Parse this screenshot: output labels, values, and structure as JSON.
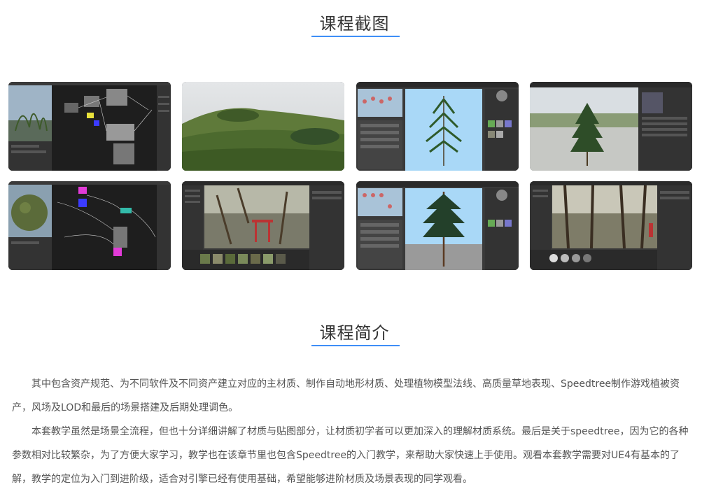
{
  "screenshots_section": {
    "title": "课程截图"
  },
  "gallery": [
    {
      "id": "shot-1",
      "alt": "材质节点编辑器"
    },
    {
      "id": "shot-2",
      "alt": "草地场景"
    },
    {
      "id": "shot-3",
      "alt": "Speedtree 树木编辑"
    },
    {
      "id": "shot-4",
      "alt": "树木场景预览"
    },
    {
      "id": "shot-5",
      "alt": "地形材质节点"
    },
    {
      "id": "shot-6",
      "alt": "鸟居场景编辑"
    },
    {
      "id": "shot-7",
      "alt": "Speedtree 杉树编辑"
    },
    {
      "id": "shot-8",
      "alt": "森林场景编辑"
    }
  ],
  "intro_section": {
    "title": "课程简介",
    "paragraphs": [
      "其中包含资产规范、为不同软件及不同资产建立对应的主材质、制作自动地形材质、处理植物模型法线、高质量草地表现、Speedtree制作游戏植被资产，风场及LOD和最后的场景搭建及后期处理调色。",
      "本套教学虽然是场景全流程，但也十分详细讲解了材质与贴图部分，让材质初学者可以更加深入的理解材质系统。最后是关于speedtree，因为它的各种参数相对比较繁杂，为了方便大家学习，教学也在该章节里也包含Speedtree的入门教学，来帮助大家快速上手使用。观看本套教学需要对UE4有基本的了解，教学的定位为入门到进阶级，适合对引擎已经有使用基础，希望能够进阶材质及场景表现的同学观看。"
    ]
  },
  "colors": {
    "accent": "#3e8ef7",
    "text": "#555555",
    "title": "#333333"
  }
}
